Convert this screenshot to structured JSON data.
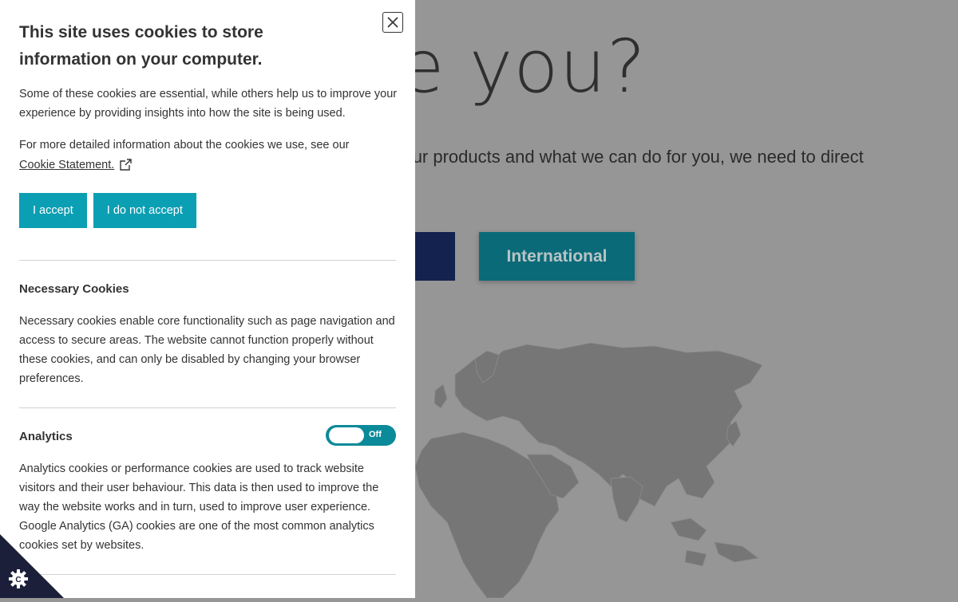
{
  "background": {
    "headline": "e you?",
    "subtext": "ut our products and what we can do for you, we need to direct",
    "international_label": "International"
  },
  "panel": {
    "title": "This site uses cookies to store information on your computer.",
    "intro": "Some of these cookies are essential, while others help us to improve your experience by providing insights into how the site is being used.",
    "more_info": "For more detailed information about the cookies we use, see our",
    "statement_link": "Cookie Statement.",
    "accept_label": "I accept",
    "reject_label": "I do not accept"
  },
  "necessary": {
    "title": "Necessary Cookies",
    "body": "Necessary cookies enable core functionality such as page navigation and access to secure areas. The website cannot function properly without these cookies, and can only be disabled by changing your browser preferences."
  },
  "analytics": {
    "title": "Analytics",
    "toggle_label": "Off",
    "body": "Analytics cookies or performance cookies are used to track website visitors and their user behaviour. This data is then used to improve the way the website works and in turn, used to improve user experience. Google Analytics (GA) cookies are one of the most common analytics cookies set by websites."
  },
  "colors": {
    "accent": "#0b9fb4",
    "toggle": "#0b8a9a",
    "navy": "#14224f",
    "teal_dark": "#0b6a78",
    "badge": "#1c1f3a"
  },
  "icons": {
    "close": "close-icon",
    "external_link": "external-link-icon",
    "cookie_badge": "cookie-settings-icon"
  }
}
